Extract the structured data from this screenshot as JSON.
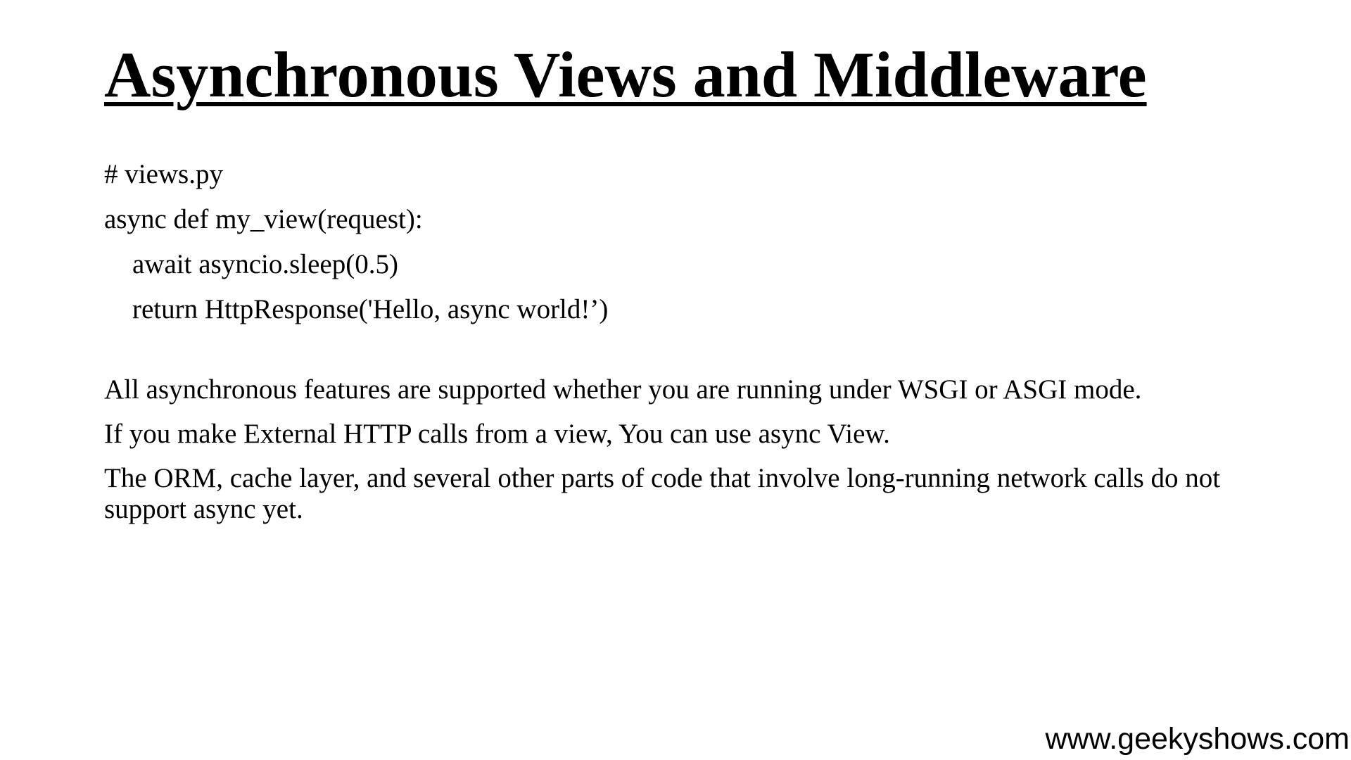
{
  "slide": {
    "title": "Asynchronous Views and Middleware",
    "code": {
      "lines": [
        "# views.py",
        "async def my_view(request):",
        "await asyncio.sleep(0.5)",
        "return HttpResponse('Hello, async world!’)"
      ]
    },
    "notes": [
      "All asynchronous features are supported whether you are running under WSGI or ASGI mode.",
      "If you make External HTTP calls from a view, You can use async View.",
      "The ORM, cache layer, and several other parts of code that involve long-running network calls do not support async yet."
    ],
    "footer_url": "www.geekyshows.com"
  }
}
